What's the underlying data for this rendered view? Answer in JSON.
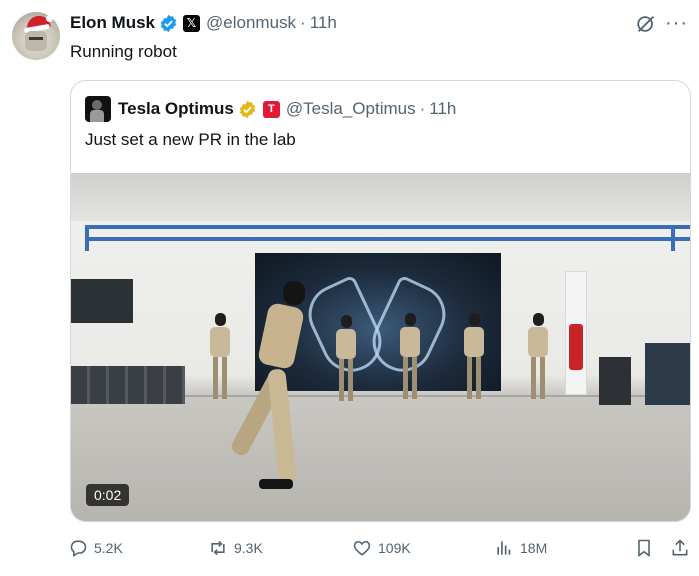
{
  "author": {
    "name": "Elon Musk",
    "handle": "@elonmusk",
    "time": "11h"
  },
  "tweet": {
    "text": "Running robot"
  },
  "quote": {
    "name": "Tesla Optimus",
    "handle": "@Tesla_Optimus",
    "time": "11h",
    "text": "Just set a new PR in the lab",
    "video": {
      "duration": "0:02"
    }
  },
  "actions": {
    "replies": "5.2K",
    "reposts": "9.3K",
    "likes": "109K",
    "views": "18M"
  },
  "icons": [
    "verified-icon",
    "x-premium-icon",
    "grok-icon",
    "more-icon",
    "gold-verified-icon",
    "tesla-icon",
    "reply-icon",
    "repost-icon",
    "like-icon",
    "views-icon",
    "bookmark-icon",
    "share-icon"
  ],
  "colors": {
    "verified": "#1d9bf0",
    "gold": "#e2b719",
    "tesla": "#e31937",
    "muted": "#536471"
  },
  "separator": "·"
}
